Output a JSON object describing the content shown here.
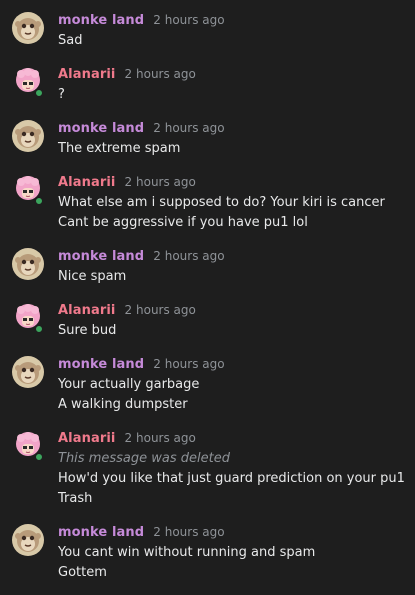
{
  "users": {
    "monke": {
      "name": "monke land",
      "color": "#c58ad8"
    },
    "alanarii": {
      "name": "Alanarii",
      "color": "#f07a8c"
    }
  },
  "status_color": "#3ba55d",
  "messages": [
    {
      "author": "monke land",
      "time": "2 hours ago",
      "lines": [
        "Sad"
      ]
    },
    {
      "author": "Alanarii",
      "time": "2 hours ago",
      "lines": [
        "?"
      ]
    },
    {
      "author": "monke land",
      "time": "2 hours ago",
      "lines": [
        "The extreme spam"
      ]
    },
    {
      "author": "Alanarii",
      "time": "2 hours ago",
      "lines": [
        "What else am i supposed to do? Your kiri is cancer",
        "Cant be aggressive if you have pu1 lol"
      ]
    },
    {
      "author": "monke land",
      "time": "2 hours ago",
      "lines": [
        "Nice spam"
      ]
    },
    {
      "author": "Alanarii",
      "time": "2 hours ago",
      "lines": [
        "Sure bud"
      ]
    },
    {
      "author": "monke land",
      "time": "2 hours ago",
      "lines": [
        "Your actually garbage",
        "A walking dumpster"
      ]
    },
    {
      "author": "Alanarii",
      "time": "2 hours ago",
      "deleted_notice": "This message was deleted",
      "lines": [
        "How'd you like that just guard prediction on your pu1",
        "Trash"
      ]
    },
    {
      "author": "monke land",
      "time": "2 hours ago",
      "lines": [
        "You cant win without running and spam",
        "Gottem"
      ]
    }
  ]
}
